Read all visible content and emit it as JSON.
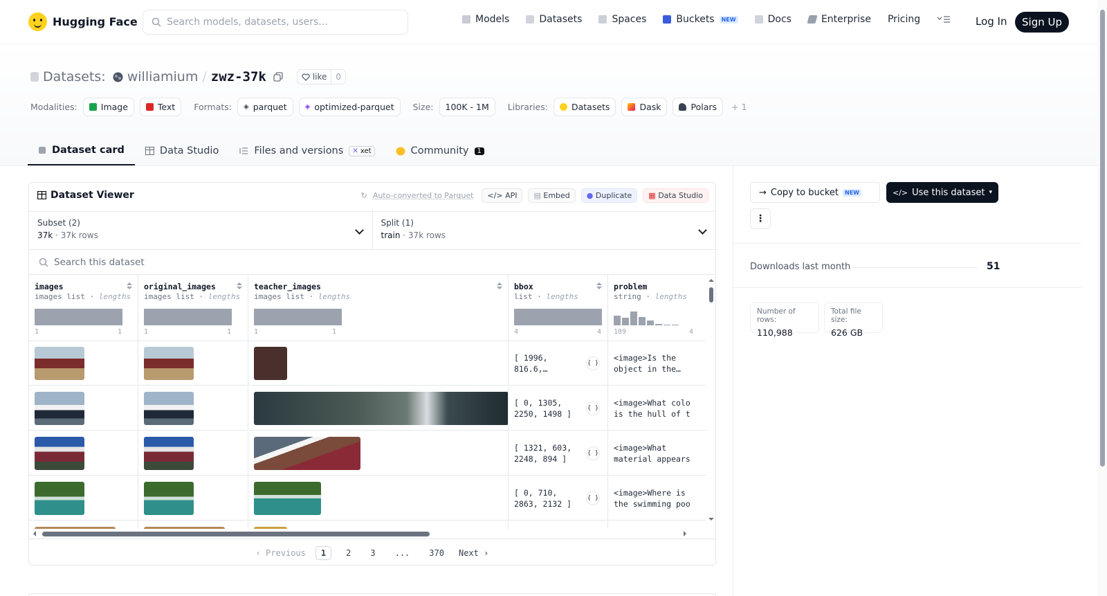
{
  "header": {
    "brand": "Hugging Face",
    "search_placeholder": "Search models, datasets, users...",
    "nav": {
      "models": "Models",
      "datasets": "Datasets",
      "spaces": "Spaces",
      "buckets": "Buckets",
      "buckets_badge": "NEW",
      "docs": "Docs",
      "enterprise": "Enterprise",
      "pricing": "Pricing"
    },
    "login": "Log In",
    "signup": "Sign Up"
  },
  "repo": {
    "type_label": "Datasets:",
    "owner": "williamium",
    "separator": "/",
    "name": "zwz-37k",
    "like_label": "like",
    "like_count": "0",
    "modalities_label": "Modalities:",
    "modalities": [
      "Image",
      "Text"
    ],
    "formats_label": "Formats:",
    "formats": [
      "parquet",
      "optimized-parquet"
    ],
    "size_label": "Size:",
    "size": "100K - 1M",
    "libraries_label": "Libraries:",
    "libraries": [
      "Datasets",
      "Dask",
      "Polars"
    ],
    "libraries_more": "+ 1"
  },
  "tabs": {
    "dataset_card": "Dataset card",
    "data_studio": "Data Studio",
    "files": "Files and versions",
    "files_badge": "xet",
    "community": "Community",
    "community_count": "1"
  },
  "viewer": {
    "title": "Dataset Viewer",
    "auto_converted": "Auto-converted to Parquet",
    "api": "API",
    "embed": "Embed",
    "duplicate": "Duplicate",
    "data_studio": "Data Studio",
    "subset_label": "Subset (2)",
    "subset_value": "37k",
    "subset_rows": "37k rows",
    "split_label": "Split (1)",
    "split_value": "train",
    "split_rows": "37k rows",
    "search_placeholder": "Search this dataset",
    "columns": [
      {
        "name": "images",
        "type": "images list",
        "stat": "lengths",
        "min": "1",
        "max": "1"
      },
      {
        "name": "original_images",
        "type": "images list",
        "stat": "lengths",
        "min": "1",
        "max": "1"
      },
      {
        "name": "teacher_images",
        "type": "images list",
        "stat": "lengths",
        "min": "1",
        "max": "1"
      },
      {
        "name": "bbox",
        "type": "list",
        "stat": "lengths",
        "min": "4",
        "max": "4"
      },
      {
        "name": "problem",
        "type": "string",
        "stat": "lengths",
        "min": "189",
        "max": "4"
      }
    ],
    "problem_histogram": [
      0.6,
      0.45,
      0.85,
      0.5,
      0.28,
      0.1,
      0.06,
      0.04
    ],
    "rows": [
      {
        "bbox": "[ 1996,\n816.6,…",
        "problem": "<image>Is the\nobject in the…"
      },
      {
        "bbox": "[ 0, 1305,\n2250, 1498 ]",
        "problem": "<image>What colo\nis the hull of t"
      },
      {
        "bbox": "[ 1321, 603,\n2248, 894 ]",
        "problem": "<image>What\nmaterial appears"
      },
      {
        "bbox": "[ 0, 710,\n2863, 2132 ]",
        "problem": "<image>Where is\nthe swimming poo"
      }
    ],
    "json_icon_label": "{ }",
    "pager": {
      "previous": "‹ Previous",
      "pages": [
        "1",
        "2",
        "3",
        "...",
        "370"
      ],
      "next": "Next ›"
    }
  },
  "sidebar": {
    "copy_bucket": "Copy to bucket",
    "copy_bucket_badge": "NEW",
    "use_dataset": "Use this dataset",
    "more": "⋮",
    "downloads_label": "Downloads last month",
    "downloads_value": "51",
    "rows_label": "Number of rows:",
    "rows_value": "110,988",
    "size_label": "Total file size:",
    "size_value": "626 GB"
  }
}
